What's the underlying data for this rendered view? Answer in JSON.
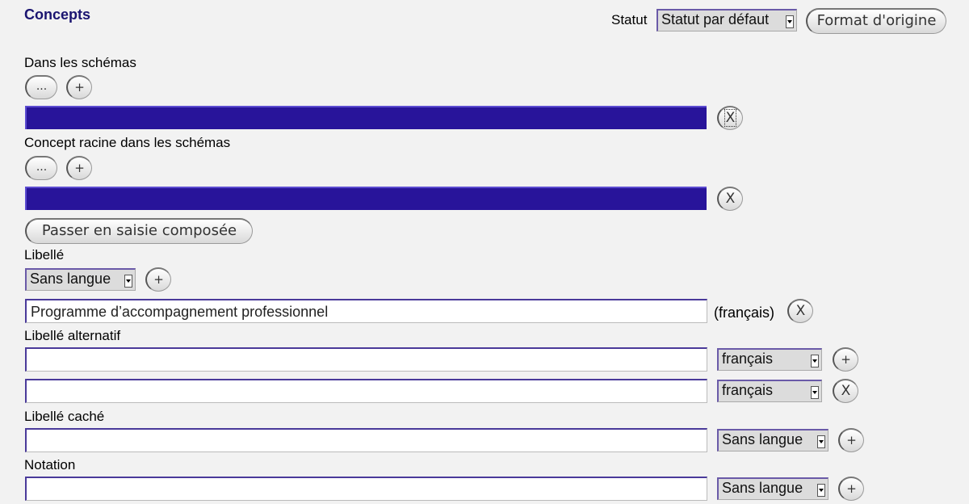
{
  "header": {
    "title": "Concepts",
    "statut_label": "Statut",
    "statut_value": "Statut par défaut",
    "format_button": "Format d'origine"
  },
  "schemes": {
    "label": "Dans les schémas",
    "browse": "...",
    "add": "+",
    "remove": "X"
  },
  "top_concepts": {
    "label": "Concept racine dans les schémas",
    "browse": "...",
    "add": "+",
    "remove": "X"
  },
  "compose_button": "Passer en saisie composée",
  "libelle": {
    "label": "Libellé",
    "lang_select": "Sans langue",
    "add": "+",
    "value": "Programme d’accompagnement professionnel",
    "lang_tag": "(français)",
    "remove": "X"
  },
  "alt_label": {
    "label": "Libellé alternatif",
    "rows": [
      {
        "value": "",
        "lang": "français",
        "action": "+"
      },
      {
        "value": "",
        "lang": "français",
        "action": "X"
      }
    ]
  },
  "hidden_label": {
    "label": "Libellé caché",
    "value": "",
    "lang": "Sans langue",
    "action": "+"
  },
  "notation": {
    "label": "Notation",
    "value": "",
    "lang": "Sans langue",
    "action": "+"
  }
}
